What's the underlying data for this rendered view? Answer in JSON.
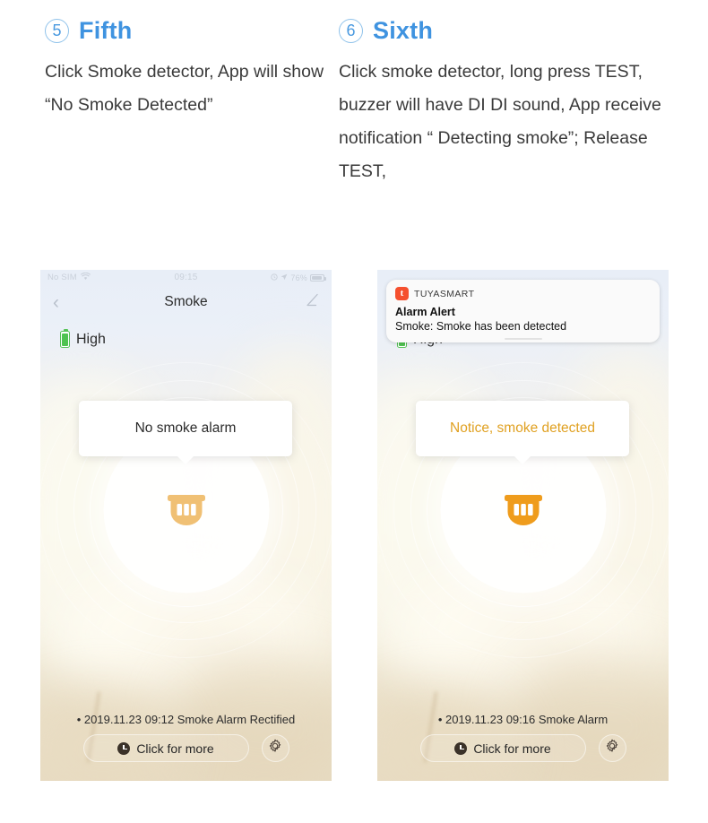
{
  "steps": [
    {
      "number": "5",
      "title": "Fifth",
      "body": "Click Smoke detector, App will show “No Smoke Detected”"
    },
    {
      "number": "6",
      "title": "Sixth",
      "body": "Click smoke detector, long press TEST, buzzer will have DI DI sound, App receive notification “ Detecting smoke”; Release TEST,"
    }
  ],
  "colors": {
    "accent_blue": "#3f93e0",
    "circle_border": "#8fc2ea",
    "alert_orange": "#e0a122",
    "icon_gold": "#f0c074",
    "icon_orange": "#ef9c1c",
    "battery_green": "#4fc351",
    "tuya_red": "#f5502e"
  },
  "phone_left": {
    "status": {
      "carrier": "No SIM",
      "wifi_icon": "wifi-icon",
      "time": "09:15",
      "location_icon": "location-arrow-icon",
      "alarm_icon": "alarm-clock-icon",
      "battery_percent": "76%",
      "battery_icon": "battery-icon"
    },
    "nav": {
      "back_icon": "chevron-left-icon",
      "title": "Smoke",
      "edit_icon": "pencil-edit-icon"
    },
    "battery_row": {
      "icon": "battery-level-icon",
      "label": "High"
    },
    "tooltip": "No smoke alarm",
    "device_icon": "smoke-detector-icon",
    "log": "• 2019.11.23 09:12 Smoke Alarm Rectified",
    "click_more": {
      "icon": "clock-icon",
      "label": "Click for more"
    },
    "settings_icon": "gear-icon"
  },
  "phone_right": {
    "notification": {
      "app_icon": "tuya-logo-icon",
      "app_icon_letter": "t",
      "app_name": "TUYASMART",
      "title": "Alarm Alert",
      "body": "Smoke: Smoke has been detected"
    },
    "battery_row": {
      "icon": "battery-level-icon",
      "label": "High"
    },
    "tooltip": "Notice, smoke detected",
    "device_icon": "smoke-detector-icon",
    "log": "• 2019.11.23 09:16 Smoke Alarm",
    "click_more": {
      "icon": "clock-icon",
      "label": "Click for more"
    },
    "settings_icon": "gear-icon"
  }
}
